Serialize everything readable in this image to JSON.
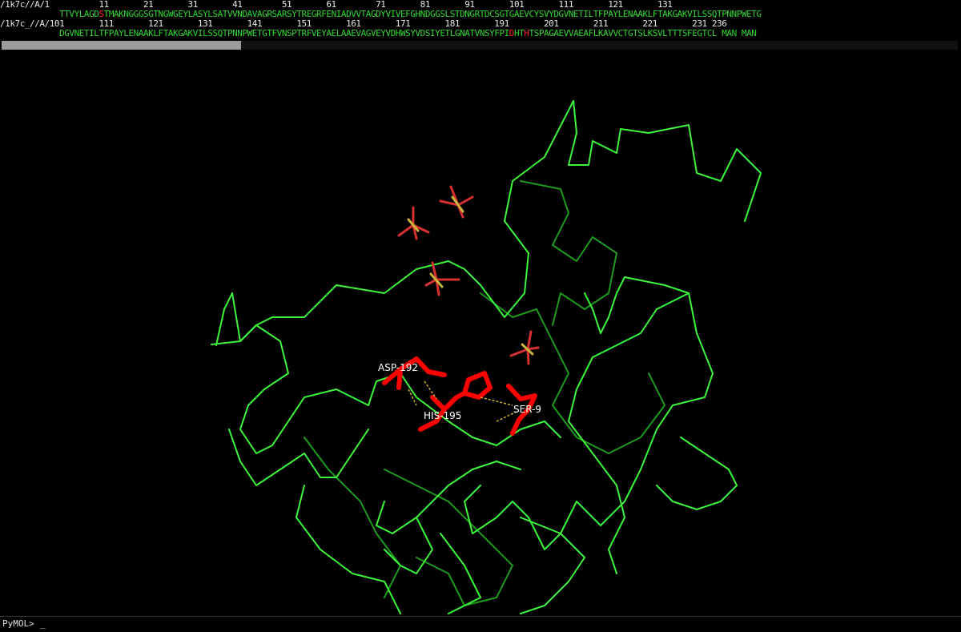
{
  "sequence_viewer": {
    "row1": {
      "numbers": "/1k7c//A/1          11       21       31       41        51       61        71       81       91       101       111       121       131",
      "residues_before": "            TTVYLAGD",
      "residues_hl": "S",
      "residues_after": "TMAKNGGGSGTNGWGEYLASYLSATVVNDAVAGRSARSYTREGRFENIADVVTAGDYVIVEFGHNDGGSLSTDNGRTDCSGTGAEVCYSVYDGVNETILTFPAYLENAAKLFTAKGAKVILSSQTPNNPWETG"
    },
    "row2": {
      "numbers": "/1k7c_//A/101       111       121       131       141       151       161       171       181       191       201       211       221       231 236",
      "residues_1": "            DGVNETILTFPAYLENAAKLFTAKGAKVILSSQTPNNPWETGTFVNSPTRFVEYAELAAEVAGVEYVDHWSYVDSIYETLGNATVNSYFPI",
      "residues_hl1": "D",
      "residues_2": "HT",
      "residues_hl2": "H",
      "residues_3": "TSPAGAEVVAEAFLKAVVCTGTSLKSVLTTTSFEGTCL MAN MAN"
    },
    "scroll_fraction": 0.25
  },
  "labels": {
    "asp": "ASP-192",
    "his": "HIS-195",
    "ser": "SER-9"
  },
  "command_line": {
    "prompt": "PyMOL>",
    "cursor": "_"
  },
  "colors": {
    "background": "#000000",
    "backbone_light": "#3df53d",
    "backbone_dark": "#1f9a1f",
    "active_site": "#ff0000",
    "sulfur": "#c8b43c",
    "oxygen": "#d83030"
  }
}
